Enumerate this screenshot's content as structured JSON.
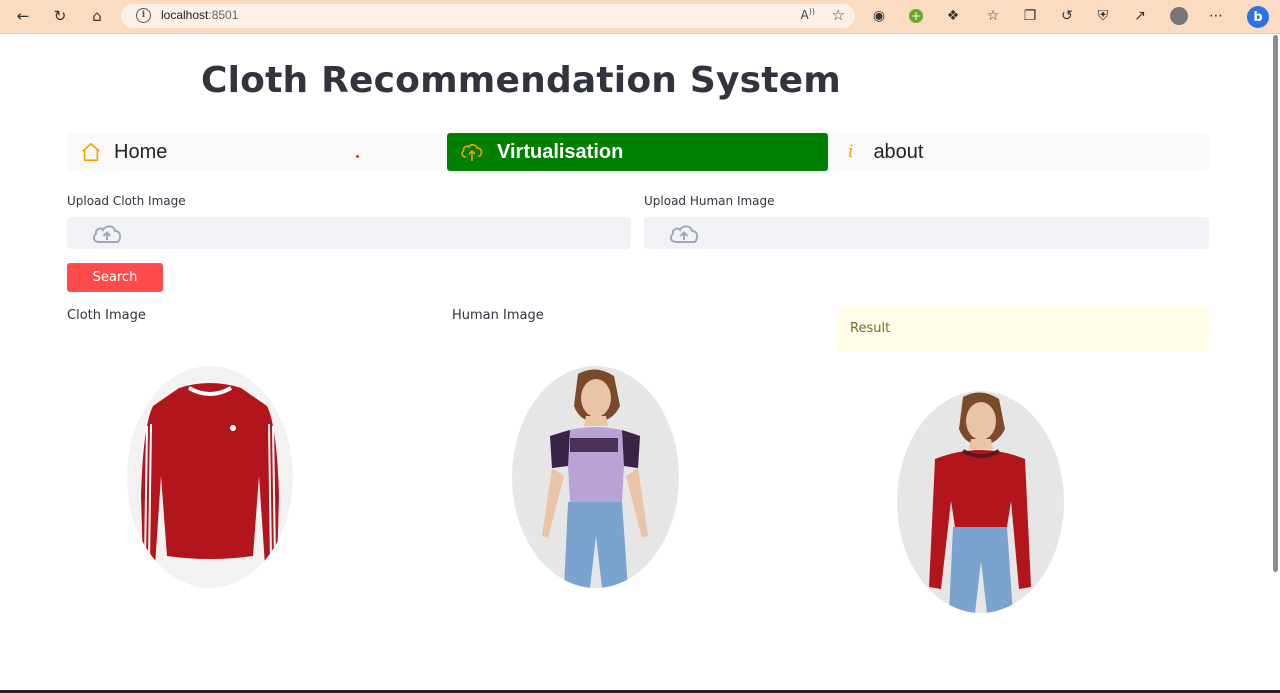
{
  "browser": {
    "url_host": "localhost",
    "url_port": ":8501",
    "read_aloud_label": "A"
  },
  "page": {
    "title": "Cloth Recommendation System"
  },
  "menu": {
    "items": [
      {
        "label": "Home",
        "icon": "home-icon"
      },
      {
        "label": "Virtualisation",
        "icon": "cloud-upload-icon",
        "active": true
      },
      {
        "label": "about",
        "icon": "info-icon"
      }
    ]
  },
  "uploads": {
    "cloth_label": "Upload Cloth Image",
    "human_label": "Upload Human Image"
  },
  "search_button": "Search",
  "columns": {
    "cloth": "Cloth Image",
    "human": "Human Image",
    "result": "Result"
  },
  "colors": {
    "accent_active": "#008000",
    "button": "#ff4b4b",
    "result_bg": "#fffce7"
  }
}
